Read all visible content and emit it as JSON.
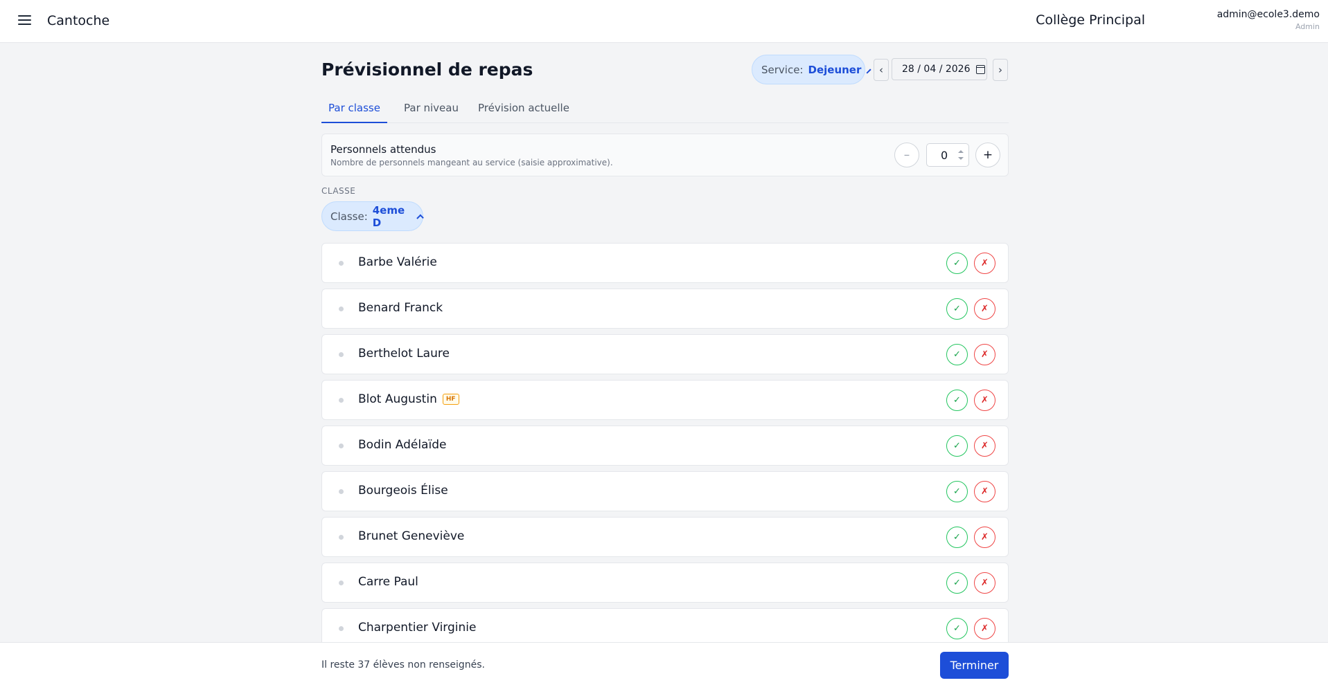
{
  "header": {
    "app_title": "Cantoche",
    "school": "Collège Principal",
    "user_email": "admin@ecole3.demo",
    "user_role": "Admin",
    "menu_icon": "hamburger-menu-icon"
  },
  "page": {
    "title": "Prévisionnel de repas",
    "service_label": "Service:",
    "service_value": "Dejeuner",
    "prev_arrow": "‹",
    "next_arrow": "›",
    "date": "28 / 04 / 2026"
  },
  "tabs": [
    {
      "label": "Par classe",
      "active": true
    },
    {
      "label": "Par niveau",
      "active": false
    },
    {
      "label": "Prévision actuelle",
      "active": false
    }
  ],
  "staff": {
    "title": "Personnels attendus",
    "description": "Nombre de personnels mangeant au service (saisie approximative).",
    "minus": "–",
    "plus": "+",
    "count": "0"
  },
  "classe": {
    "section_label": "CLASSE",
    "chip_label": "Classe:",
    "chip_value": "4eme D"
  },
  "students": [
    {
      "name": "Barbe Valérie",
      "tag": ""
    },
    {
      "name": "Benard Franck",
      "tag": ""
    },
    {
      "name": "Berthelot Laure",
      "tag": ""
    },
    {
      "name": "Blot Augustin",
      "tag": "HF"
    },
    {
      "name": "Bodin Adélaïde",
      "tag": ""
    },
    {
      "name": "Bourgeois Élise",
      "tag": ""
    },
    {
      "name": "Brunet Geneviève",
      "tag": ""
    },
    {
      "name": "Carre Paul",
      "tag": ""
    },
    {
      "name": "Charpentier Virginie",
      "tag": ""
    }
  ],
  "row_buttons": {
    "yes": "✓",
    "no": "✗"
  },
  "footer": {
    "message": "Il reste 37 élèves non renseignés.",
    "finish_label": "Terminer"
  }
}
